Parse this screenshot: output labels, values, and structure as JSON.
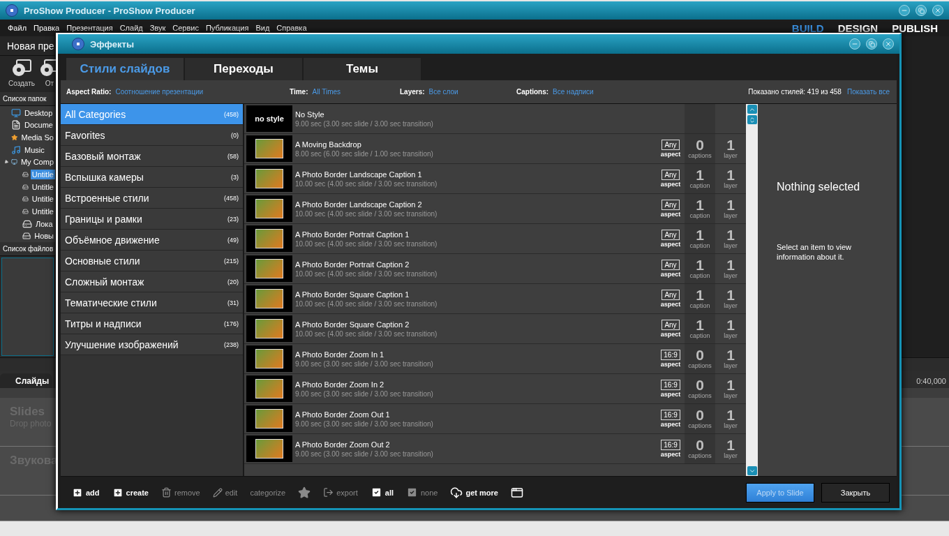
{
  "window": {
    "title": "ProShow Producer - ProShow Producer"
  },
  "menu": [
    "Файл",
    "Правка",
    "Презентация",
    "Слайд",
    "Звук",
    "Сервис",
    "Публикация",
    "Вид",
    "Справка"
  ],
  "modes": [
    {
      "label": "BUILD",
      "selected": true
    },
    {
      "label": "DESIGN",
      "selected": false
    },
    {
      "label": "PUBLISH",
      "selected": false
    }
  ],
  "left_panel": {
    "show_title": "Новая пре",
    "tools": [
      "Создать",
      "От"
    ],
    "folders_header": "Список папок",
    "tree": [
      {
        "label": "Desktop",
        "kind": "desktop",
        "selected": false
      },
      {
        "label": "Docume",
        "kind": "document",
        "selected": false
      },
      {
        "label": "Media So",
        "kind": "star",
        "selected": false
      },
      {
        "label": "Music",
        "kind": "music",
        "selected": false
      },
      {
        "label": "My Comp",
        "kind": "computer",
        "selected": false,
        "expanded": true,
        "children": [
          {
            "label": "Untitle",
            "kind": "drive",
            "selected": true
          },
          {
            "label": "Untitle",
            "kind": "drive",
            "selected": false
          },
          {
            "label": "Untitle",
            "kind": "drive",
            "selected": false
          },
          {
            "label": "Untitle",
            "kind": "drive",
            "selected": false
          },
          {
            "label": "Лока",
            "kind": "drive",
            "selected": false
          },
          {
            "label": "Новы",
            "kind": "drive",
            "selected": false
          }
        ]
      }
    ],
    "files_header": "Список файлов"
  },
  "timeline": {
    "tab": "Слайды",
    "time_mark": "0:40,000",
    "slides_title": "Slides",
    "slides_hint": "Drop photo",
    "audio_title": "Звукова"
  },
  "dialog": {
    "title": "Эффекты",
    "tabs": [
      {
        "label": "Стили слайдов",
        "selected": true
      },
      {
        "label": "Переходы",
        "selected": false
      },
      {
        "label": "Темы",
        "selected": false
      }
    ],
    "filters": [
      {
        "label": "Aspect Ratio:",
        "value": "Соотношение презентации"
      },
      {
        "label": "Time:",
        "value": "All Times"
      },
      {
        "label": "Layers:",
        "value": "Все слои"
      },
      {
        "label": "Captions:",
        "value": "Все надписи"
      }
    ],
    "shown_count": "Показано стилей: 419 из 458",
    "show_all": "Показать все",
    "categories": [
      {
        "name": "All Categories",
        "count": "(458)",
        "selected": true
      },
      {
        "name": "Favorites",
        "count": "(0)",
        "selected": false
      },
      {
        "name": "Базовый монтаж",
        "count": "(58)",
        "selected": false
      },
      {
        "name": "Вспышка камеры",
        "count": "(3)",
        "selected": false
      },
      {
        "name": "Встроенные стили",
        "count": "(458)",
        "selected": false
      },
      {
        "name": "Границы и рамки",
        "count": "(23)",
        "selected": false
      },
      {
        "name": "Объёмное движение",
        "count": "(49)",
        "selected": false
      },
      {
        "name": "Основные стили",
        "count": "(215)",
        "selected": false
      },
      {
        "name": "Сложный монтаж",
        "count": "(20)",
        "selected": false
      },
      {
        "name": "Тематические стили",
        "count": "(31)",
        "selected": false
      },
      {
        "name": "Титры и надписи",
        "count": "(176)",
        "selected": false
      },
      {
        "name": "Улучшение изображений",
        "count": "(238)",
        "selected": false
      }
    ],
    "styles": [
      {
        "kind": "none",
        "thumb_text": "no style",
        "name": "No Style",
        "duration": "9.00 sec (3.00 sec slide / 3.00 sec transition)"
      },
      {
        "kind": "style",
        "name": "A Moving Backdrop",
        "duration": "8.00 sec (6.00 sec slide / 1.00 sec transition)",
        "aspect": "Any",
        "aspect_label": "aspect",
        "captions": "0",
        "captions_label": "captions",
        "layers": "1",
        "layers_label": "layer"
      },
      {
        "kind": "style",
        "name": "A Photo Border Landscape Caption 1",
        "duration": "10.00 sec (4.00 sec slide / 3.00 sec transition)",
        "aspect": "Any",
        "aspect_label": "aspect",
        "captions": "1",
        "captions_label": "caption",
        "layers": "1",
        "layers_label": "layer"
      },
      {
        "kind": "style",
        "name": "A Photo Border Landscape Caption 2",
        "duration": "10.00 sec (4.00 sec slide / 3.00 sec transition)",
        "aspect": "Any",
        "aspect_label": "aspect",
        "captions": "1",
        "captions_label": "caption",
        "layers": "1",
        "layers_label": "layer"
      },
      {
        "kind": "style",
        "name": "A Photo Border Portrait Caption 1",
        "duration": "10.00 sec (4.00 sec slide / 3.00 sec transition)",
        "aspect": "Any",
        "aspect_label": "aspect",
        "captions": "1",
        "captions_label": "caption",
        "layers": "1",
        "layers_label": "layer"
      },
      {
        "kind": "style",
        "name": "A Photo Border Portrait Caption 2",
        "duration": "10.00 sec (4.00 sec slide / 3.00 sec transition)",
        "aspect": "Any",
        "aspect_label": "aspect",
        "captions": "1",
        "captions_label": "caption",
        "layers": "1",
        "layers_label": "layer"
      },
      {
        "kind": "style",
        "name": "A Photo Border Square Caption 1",
        "duration": "10.00 sec (4.00 sec slide / 3.00 sec transition)",
        "aspect": "Any",
        "aspect_label": "aspect",
        "captions": "1",
        "captions_label": "caption",
        "layers": "1",
        "layers_label": "layer"
      },
      {
        "kind": "style",
        "name": "A Photo Border Square Caption 2",
        "duration": "10.00 sec (4.00 sec slide / 3.00 sec transition)",
        "aspect": "Any",
        "aspect_label": "aspect",
        "captions": "1",
        "captions_label": "caption",
        "layers": "1",
        "layers_label": "layer"
      },
      {
        "kind": "style",
        "name": "A Photo Border Zoom In 1",
        "duration": "9.00 sec (3.00 sec slide / 3.00 sec transition)",
        "aspect": "16:9",
        "aspect_label": "aspect",
        "captions": "0",
        "captions_label": "captions",
        "layers": "1",
        "layers_label": "layer"
      },
      {
        "kind": "style",
        "name": "A Photo Border Zoom In 2",
        "duration": "9.00 sec (3.00 sec slide / 3.00 sec transition)",
        "aspect": "16:9",
        "aspect_label": "aspect",
        "captions": "0",
        "captions_label": "captions",
        "layers": "1",
        "layers_label": "layer"
      },
      {
        "kind": "style",
        "name": "A Photo Border Zoom Out 1",
        "duration": "9.00 sec (3.00 sec slide / 3.00 sec transition)",
        "aspect": "16:9",
        "aspect_label": "aspect",
        "captions": "0",
        "captions_label": "captions",
        "layers": "1",
        "layers_label": "layer"
      },
      {
        "kind": "style",
        "name": "A Photo Border Zoom Out 2",
        "duration": "9.00 sec (3.00 sec slide / 3.00 sec transition)",
        "aspect": "16:9",
        "aspect_label": "aspect",
        "captions": "0",
        "captions_label": "captions",
        "layers": "1",
        "layers_label": "layer"
      }
    ],
    "info": {
      "title": "Nothing selected",
      "text": "Select an item to view information about it."
    },
    "toolbar": [
      {
        "kind": "add",
        "label": "add",
        "disabled": false
      },
      {
        "kind": "create",
        "label": "create",
        "disabled": false
      },
      {
        "kind": "remove",
        "label": "remove",
        "disabled": true
      },
      {
        "kind": "edit",
        "label": "edit",
        "disabled": true
      },
      {
        "kind": "categorize",
        "label": "categorize",
        "disabled": true
      },
      {
        "kind": "favorite",
        "disabled": true
      },
      {
        "kind": "export",
        "label": "export",
        "disabled": true
      },
      {
        "kind": "check",
        "label": "all",
        "checked": true,
        "disabled": false
      },
      {
        "kind": "check",
        "label": "none",
        "checked": true,
        "disabled": true
      },
      {
        "kind": "get_more",
        "label": "get more",
        "disabled": false
      },
      {
        "kind": "window",
        "disabled": false
      }
    ],
    "buttons": [
      {
        "label": "Apply to Slide",
        "kind": "primary",
        "disabled": true
      },
      {
        "label": "Закрыть",
        "kind": "secondary",
        "disabled": false
      }
    ]
  }
}
